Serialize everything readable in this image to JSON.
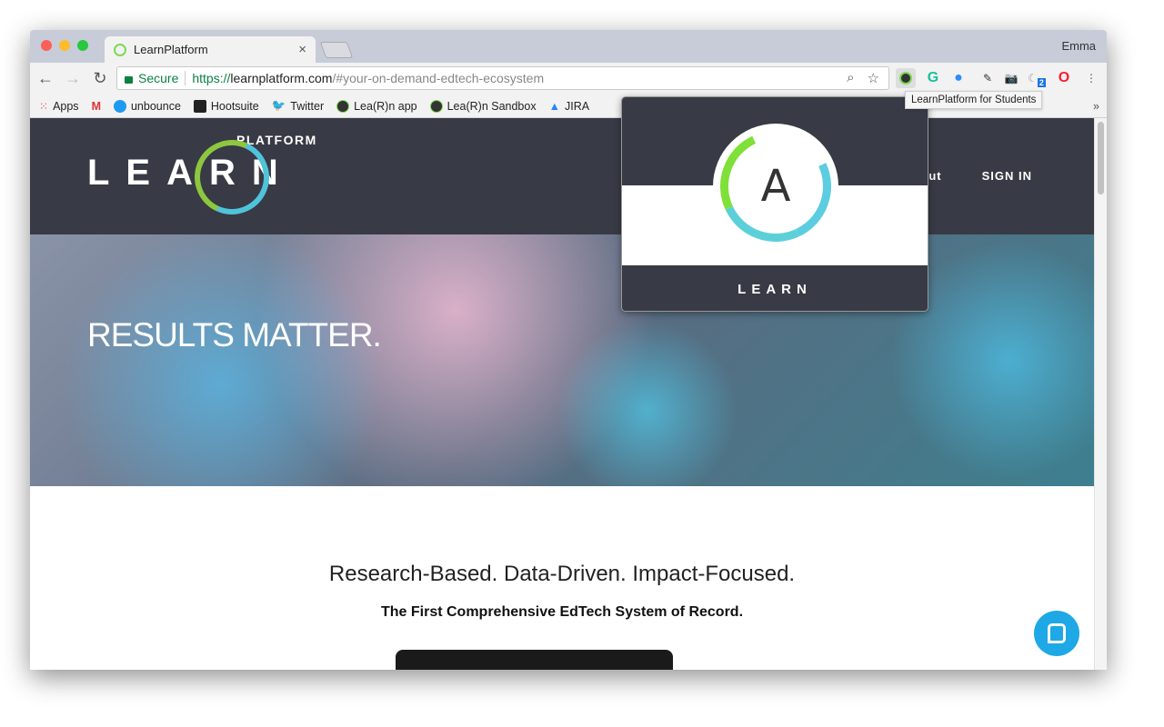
{
  "tab": {
    "title": "LearnPlatform",
    "close": "×"
  },
  "user": "Emma",
  "address": {
    "secure": "Secure",
    "scheme": "https://",
    "host": "learnplatform.com",
    "path": "/#your-on-demand-edtech-ecosystem"
  },
  "bookmarks": [
    {
      "label": "Apps"
    },
    {
      "label": ""
    },
    {
      "label": "unbounce"
    },
    {
      "label": "Hootsuite"
    },
    {
      "label": "Twitter"
    },
    {
      "label": "Lea(R)n app"
    },
    {
      "label": "Lea(R)n Sandbox"
    },
    {
      "label": "JIRA"
    }
  ],
  "bookmarks_more": "»",
  "extensions": {
    "badge_count": "2",
    "tooltip": "LearnPlatform for Students"
  },
  "site": {
    "logo_main": "LEARN",
    "logo_sub": "PLATFORM",
    "nav": [
      "About",
      "SIGN IN"
    ],
    "hero_title": "RESULTS MATTER.",
    "tagline": "Research-Based. Data-Driven. Impact-Focused.",
    "subtagline": "The First Comprehensive EdTech System of Record."
  },
  "popup": {
    "grade": "A",
    "footer_logo": "LEARN"
  },
  "colors": {
    "header": "#383a45",
    "accent_green": "#8dc63f",
    "accent_blue": "#4fc3d9",
    "chat": "#1ea8e6"
  }
}
